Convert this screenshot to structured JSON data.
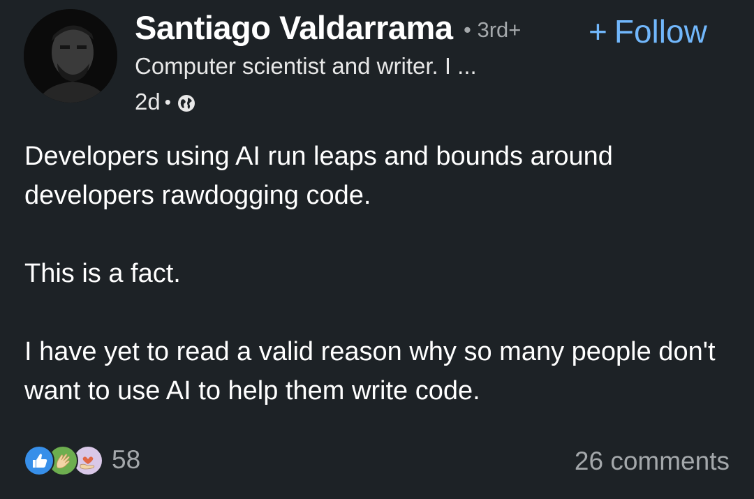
{
  "author": {
    "name": "Santiago Valdarrama",
    "degree": "• 3rd+",
    "headline": "Computer scientist and writer. I ...",
    "time": "2d"
  },
  "follow": {
    "plus": "+",
    "label": "Follow"
  },
  "meta": {
    "separator": "•",
    "visibility_icon": "globe-icon"
  },
  "post": {
    "paragraphs": [
      "Developers using AI run leaps and bounds around developers rawdogging code.",
      "This is a fact.",
      "I have yet to read a valid reason why so many people don't want to use AI to help them write code."
    ]
  },
  "social": {
    "reaction_icons": [
      "like-icon",
      "celebrate-icon",
      "support-icon"
    ],
    "reaction_count": "58",
    "comments": "26 comments"
  },
  "colors": {
    "background": "#1d2226",
    "accent": "#71b7fb",
    "muted": "#a4a8ab"
  }
}
